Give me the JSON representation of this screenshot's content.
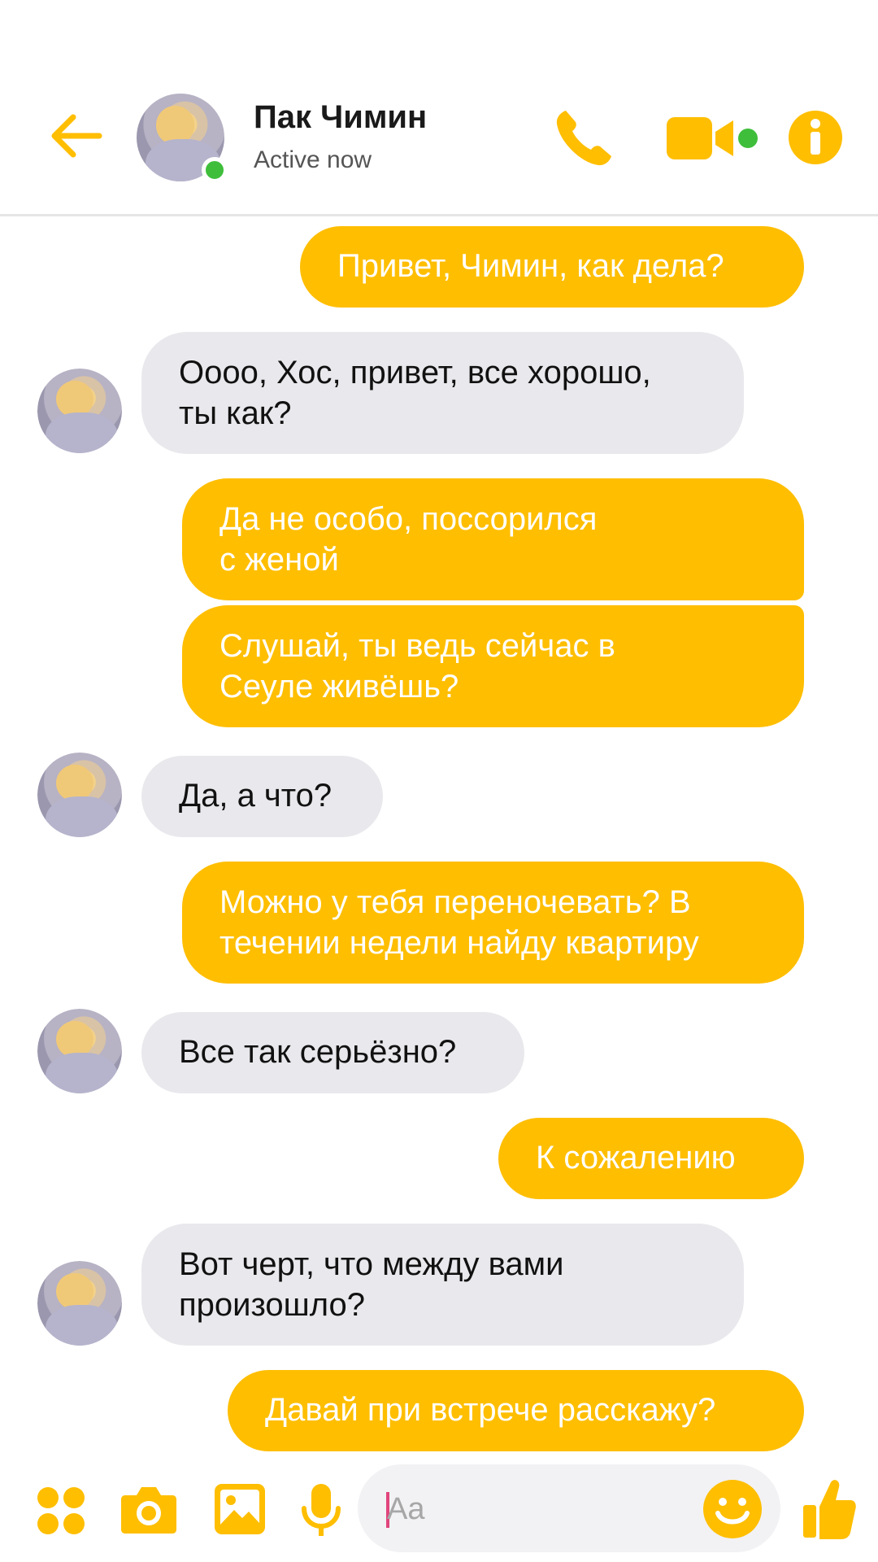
{
  "header": {
    "back_icon": "arrow-left-icon",
    "contact_name": "Пак Чимин",
    "status": "Active now",
    "call_icon": "phone-icon",
    "video_icon": "video-camera-icon",
    "info_icon": "info-icon"
  },
  "messages": [
    {
      "side": "out",
      "text": "Привет, Чимин, как дела?"
    },
    {
      "side": "in",
      "text": "Оооо, Хос, привет, все хорошо,\nты как?"
    },
    {
      "side": "out",
      "text": "Да не особо, поссорился\nс женой"
    },
    {
      "side": "out",
      "text": "Слушай, ты ведь сейчас в\nСеуле живёшь?"
    },
    {
      "side": "in",
      "text": "Да, а что?"
    },
    {
      "side": "out",
      "text": "Можно у тебя переночевать? В\nтечении недели найду квартиру"
    },
    {
      "side": "in",
      "text": "Все так серьёзно?"
    },
    {
      "side": "out",
      "text": "К сожалению"
    },
    {
      "side": "in",
      "text": "Вот черт, что между вами\nпроизошло?"
    },
    {
      "side": "out",
      "text": "Давай при встрече расскажу?"
    }
  ],
  "composer": {
    "placeholder": "Aa",
    "icons": [
      "apps-icon",
      "camera-icon",
      "image-icon",
      "microphone-icon",
      "emoji-icon",
      "thumbs-up-icon"
    ]
  },
  "colors": {
    "accent": "#FFBE00",
    "incoming_bubble": "#E9E8EC",
    "online": "#3FBE3C"
  }
}
